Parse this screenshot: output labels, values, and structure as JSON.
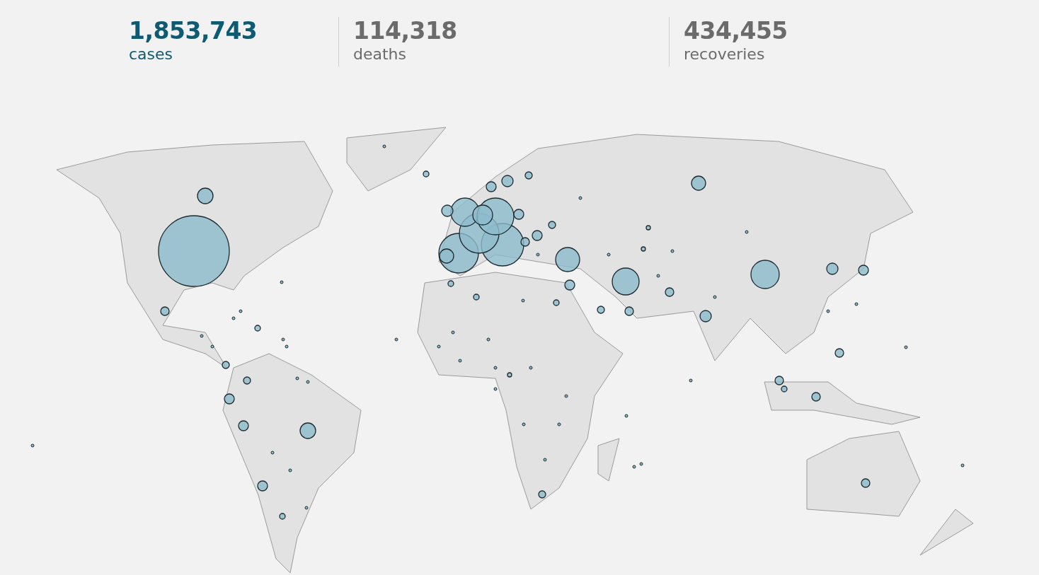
{
  "stats": [
    {
      "value": "1,853,743",
      "label": "cases",
      "selected": true
    },
    {
      "value": "114,318",
      "label": "deaths",
      "selected": false
    },
    {
      "value": "434,455",
      "label": "recoveries",
      "selected": false
    }
  ]
}
